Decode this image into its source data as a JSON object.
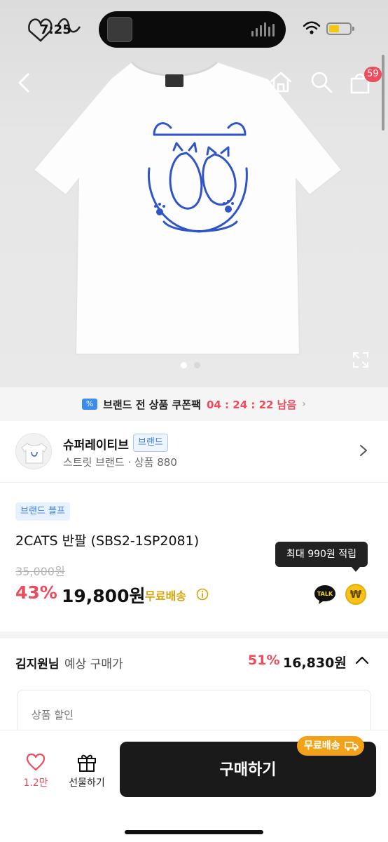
{
  "status_bar": {
    "time": "7:25"
  },
  "header": {
    "cart_count": "59"
  },
  "coupon": {
    "text": "브랜드 전 상품 쿠폰팩",
    "timer": "04 : 24 : 22 남음"
  },
  "brand": {
    "name": "슈퍼레이티브",
    "tag": "브랜드",
    "sub": "스트릿 브랜드 · 상품 880"
  },
  "product": {
    "promo_tag": "브랜드 블프",
    "title": "2CATS 반팔 (SBS2-1SP2081)",
    "original_price": "35,000원",
    "discount": "43%",
    "price": "19,800원",
    "shipping": "무료배송",
    "tooltip": "최대 990원 적립"
  },
  "expected": {
    "name": "김지원님",
    "label": "예상 구매가",
    "discount": "51%",
    "price": "16,830원"
  },
  "discount_box": {
    "label": "상품 할인"
  },
  "bottom": {
    "like_count": "1.2만",
    "gift_label": "선물하기",
    "buy_label": "구매하기",
    "ship_pill": "무료배송"
  },
  "icons": [
    "back-icon",
    "home-icon",
    "search-icon",
    "shopping-bag-icon",
    "expand-icon",
    "coupon-icon",
    "info-icon",
    "kakao-talk-icon",
    "won-coin-icon",
    "chevron-right-icon",
    "chevron-up-icon",
    "heart-icon",
    "gift-icon",
    "truck-icon",
    "wifi-icon",
    "battery-icon"
  ],
  "colors": {
    "accent_red": "#ee4b5c",
    "brand_blue": "#3b7fe0",
    "shipping_gold": "#d9a20a",
    "button_dark": "#1a1a1a",
    "ship_pill_orange": "#f4a11a"
  }
}
